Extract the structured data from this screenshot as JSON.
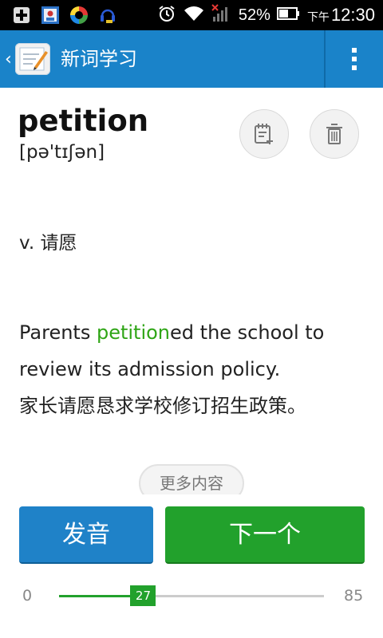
{
  "status_bar": {
    "battery_percent": "52%",
    "time_prefix": "下午",
    "time": "12:30"
  },
  "action_bar": {
    "title": "新词学习"
  },
  "word": {
    "text": "petition",
    "phonetic": "[pə'tɪʃən]"
  },
  "meaning": "v. 请愿",
  "example": {
    "before": "Parents ",
    "highlight": "petition",
    "after": "ed the school to review its admission policy.",
    "translation": "家长请愿恳求学校修订招生政策。"
  },
  "buttons": {
    "more": "更多内容",
    "pronounce": "发音",
    "next": "下一个"
  },
  "progress": {
    "min": "0",
    "max": "85",
    "current": "27"
  },
  "colors": {
    "action_bar": "#1a83c9",
    "highlight": "#2fa516",
    "next_button": "#22a12c",
    "pronounce_button": "#1f82c8"
  }
}
